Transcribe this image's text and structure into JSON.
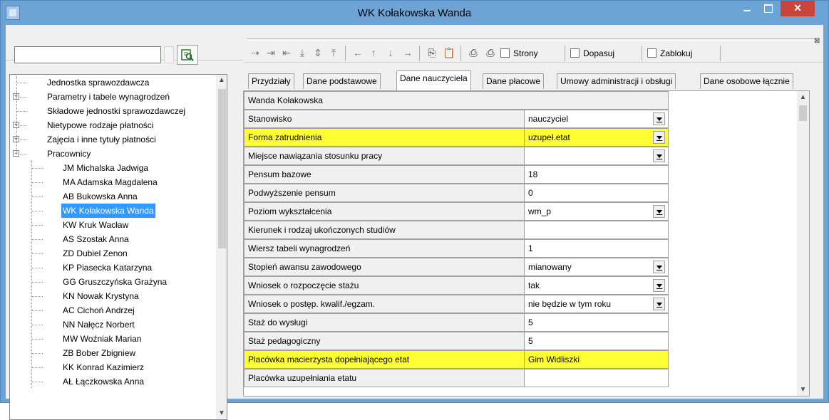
{
  "window": {
    "title": "WK Kołakowska Wanda"
  },
  "search": {
    "value": ""
  },
  "tree": {
    "items": [
      {
        "label": "Jednostka sprawozdawcza",
        "level": 0,
        "expander": ""
      },
      {
        "label": "Parametry i tabele wynagrodzeń",
        "level": 0,
        "expander": "+"
      },
      {
        "label": "Składowe jednostki sprawozdawczej",
        "level": 0,
        "expander": ""
      },
      {
        "label": "Nietypowe rodzaje płatności",
        "level": 0,
        "expander": "+"
      },
      {
        "label": "Zajęcia i inne tytuły płatności",
        "level": 0,
        "expander": "+"
      },
      {
        "label": "Pracownicy",
        "level": 0,
        "expander": "-"
      },
      {
        "label": "JM Michalska Jadwiga",
        "level": 1
      },
      {
        "label": "MA Adamska Magdalena",
        "level": 1
      },
      {
        "label": "AB Bukowska Anna",
        "level": 1
      },
      {
        "label": "WK Kołakowska Wanda",
        "level": 1,
        "selected": true
      },
      {
        "label": "KW Kruk Wacław",
        "level": 1
      },
      {
        "label": "AS Szostak Anna",
        "level": 1
      },
      {
        "label": "ZD Dubiel Zenon",
        "level": 1
      },
      {
        "label": "KP Piasecka Katarzyna",
        "level": 1
      },
      {
        "label": "GG Gruszczyńska Grażyna",
        "level": 1
      },
      {
        "label": "KN Nowak Krystyna",
        "level": 1
      },
      {
        "label": "AC Cichoń Andrzej",
        "level": 1
      },
      {
        "label": "NN Nałęcz Norbert",
        "level": 1
      },
      {
        "label": "MW Woźniak Marian",
        "level": 1
      },
      {
        "label": "ZB Bober Zbigniew",
        "level": 1
      },
      {
        "label": "KK Konrad Kazimierz",
        "level": 1
      },
      {
        "label": "AŁ Łączkowska Anna",
        "level": 1
      }
    ]
  },
  "toolbar": {
    "checks": [
      {
        "label": "Strony"
      },
      {
        "label": "Dopasuj"
      },
      {
        "label": "Zablokuj"
      }
    ]
  },
  "tabs": [
    {
      "label": "Przydziały"
    },
    {
      "label": "Dane podstawowe"
    },
    {
      "label": "Dane nauczyciela",
      "active": true
    },
    {
      "label": "Dane płacowe"
    },
    {
      "label": "Umowy administracji i obsługi"
    },
    {
      "label": "Dane osobowe łącznie"
    }
  ],
  "grid": {
    "header": "Wanda Kołakowska",
    "rows": [
      {
        "label": "Stanowisko",
        "value": "nauczyciel",
        "dropdown": true
      },
      {
        "label": "Forma zatrudnienia",
        "value": "uzupeł.etat",
        "dropdown": true,
        "highlight": true
      },
      {
        "label": "Miejsce nawiązania stosunku pracy",
        "value": "",
        "dropdown": true
      },
      {
        "label": "Pensum bazowe",
        "value": "18"
      },
      {
        "label": "Podwyższenie pensum",
        "value": "0"
      },
      {
        "label": "Poziom wykształcenia",
        "value": "wm_p",
        "dropdown": true
      },
      {
        "label": "Kierunek i rodzaj ukończonych studiów",
        "value": ""
      },
      {
        "label": "Wiersz tabeli wynagrodzeń",
        "value": "1"
      },
      {
        "label": "Stopień awansu zawodowego",
        "value": "mianowany",
        "dropdown": true
      },
      {
        "label": "Wniosek o rozpoczęcie stażu",
        "value": "tak",
        "dropdown": true
      },
      {
        "label": "Wniosek o postęp. kwalif./egzam.",
        "value": "nie będzie w tym roku",
        "dropdown": true
      },
      {
        "label": "Staż do wysługi",
        "value": "5"
      },
      {
        "label": "Staż pedagogiczny",
        "value": "5"
      },
      {
        "label": "Placówka macierzysta dopełniającego etat",
        "value": "Gim Widliszki",
        "highlight": true
      },
      {
        "label": "Placówka uzupełniania etatu",
        "value": ""
      }
    ]
  },
  "colors": {
    "titlebar": "#6ea3d5",
    "highlight": "#ffff33",
    "selection": "#3399ff",
    "close": "#c7453a"
  }
}
